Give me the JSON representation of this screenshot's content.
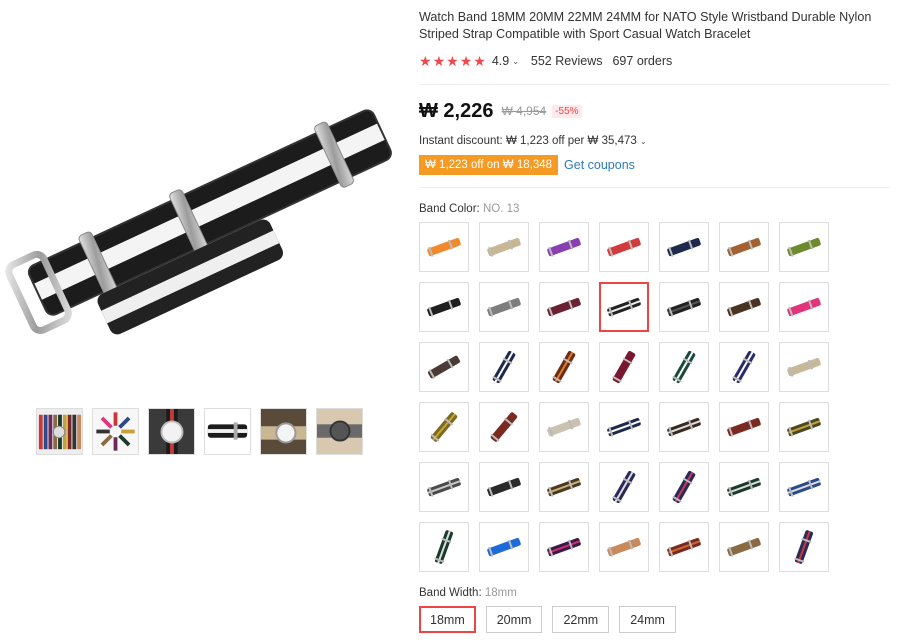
{
  "product": {
    "title": "Watch Band 18MM 20MM 22MM 24MM for NATO Style Wristband Durable Nylon Striped Strap Compatible with Sport Casual Watch Bracelet",
    "rating": "4.9",
    "rating_caret": "⌄",
    "stars_count": 5,
    "reviews": "552 Reviews",
    "orders": "697 orders"
  },
  "price": {
    "current": "₩ 2,226",
    "original": "₩ 4,954",
    "discount": "-55%",
    "instant_discount": "Instant discount: ₩ 1,223 off per ₩ 35,473",
    "instant_caret": "⌄",
    "coupon_badge": "₩ 1,223 off on ₩ 18,348",
    "get_coupons": "Get coupons"
  },
  "band_color": {
    "label": "Band Color:",
    "selected": "NO. 13",
    "swatches": [
      {
        "colors": [
          "#f08a2c",
          "#f08a2c"
        ]
      },
      {
        "colors": [
          "#c9b693",
          "#c9b693"
        ]
      },
      {
        "colors": [
          "#8a3fb0",
          "#8a3fb0"
        ]
      },
      {
        "colors": [
          "#d23b3b",
          "#d23b3b"
        ]
      },
      {
        "colors": [
          "#1d2a4d",
          "#1d2a4d"
        ]
      },
      {
        "colors": [
          "#a2612f",
          "#a2612f"
        ]
      },
      {
        "colors": [
          "#6f8a2d",
          "#6f8a2d"
        ]
      },
      {
        "colors": [
          "#1f1f1f",
          "#1f1f1f"
        ]
      },
      {
        "colors": [
          "#7d7d7d",
          "#7d7d7d"
        ]
      },
      {
        "colors": [
          "#6a2232",
          "#6a2232"
        ]
      },
      {
        "colors": [
          "#222222",
          "#eeeeee"
        ]
      },
      {
        "colors": [
          "#222222",
          "#555555"
        ]
      },
      {
        "colors": [
          "#4a3322",
          "#4a3322"
        ]
      },
      {
        "colors": [
          "#e0357a",
          "#e0357a"
        ]
      },
      {
        "colors": [
          "#4a3b36",
          "#4a3b36"
        ]
      },
      {
        "colors": [
          "#1e2a4d",
          "#ffffff"
        ]
      },
      {
        "colors": [
          "#6e2a15",
          "#d9822b"
        ]
      },
      {
        "colors": [
          "#7a1730",
          "#7a1730"
        ]
      },
      {
        "colors": [
          "#1a4a3a",
          "#ffffff"
        ]
      },
      {
        "colors": [
          "#2a2d6a",
          "#ffffff"
        ]
      },
      {
        "colors": [
          "#c8b89a",
          "#c8b89a"
        ]
      },
      {
        "colors": [
          "#7c6a22",
          "#c9a62e"
        ]
      },
      {
        "colors": [
          "#7b2a22",
          "#7b2a22"
        ]
      },
      {
        "colors": [
          "#c9c2b0",
          "#c9c2b0"
        ]
      },
      {
        "colors": [
          "#1e2a4d",
          "#ffffff"
        ]
      },
      {
        "colors": [
          "#3a2a22",
          "#e0e0e0"
        ]
      },
      {
        "colors": [
          "#7b2a22",
          "#7b2a22"
        ]
      },
      {
        "colors": [
          "#4a4a22",
          "#c8a03a"
        ]
      },
      {
        "colors": [
          "#4a4a4a",
          "#c9c9c9"
        ]
      },
      {
        "colors": [
          "#2a2a2a",
          "#2a2a2a"
        ]
      },
      {
        "colors": [
          "#4a3a22",
          "#c8b07a"
        ]
      },
      {
        "colors": [
          "#2a2a5a",
          "#dddddd"
        ]
      },
      {
        "colors": [
          "#2a2a5a",
          "#c83a5a"
        ]
      },
      {
        "colors": [
          "#1a3a2a",
          "#dddddd"
        ]
      },
      {
        "colors": [
          "#2a4a8a",
          "#dddddd"
        ]
      },
      {
        "colors": [
          "#1a3a2a",
          "#dddddd"
        ]
      },
      {
        "colors": [
          "#1e6ad8",
          "#1e6ad8"
        ]
      },
      {
        "colors": [
          "#3a1a4a",
          "#c8306a"
        ]
      },
      {
        "colors": [
          "#c88a5a",
          "#c88a5a"
        ]
      },
      {
        "colors": [
          "#7a2a22",
          "#c86a2a"
        ]
      },
      {
        "colors": [
          "#8a6a42",
          "#8a6a42"
        ]
      },
      {
        "colors": [
          "#2a2a5a",
          "#c83a3a"
        ]
      }
    ]
  },
  "band_width": {
    "label": "Band Width:",
    "selected": "18mm",
    "options": [
      "18mm",
      "20mm",
      "22mm",
      "24mm"
    ]
  },
  "thumbnails": [
    {
      "name": "thumb-multicolor-stack"
    },
    {
      "name": "thumb-color-wheel"
    },
    {
      "name": "thumb-wrist-silver"
    },
    {
      "name": "thumb-black-white"
    },
    {
      "name": "thumb-wrist-dark"
    },
    {
      "name": "thumb-wrist-gray"
    }
  ],
  "colors": {
    "accent": "#e44444",
    "star": "#f0484b",
    "coupon": "#f59a23",
    "link": "#2f7ab9"
  }
}
